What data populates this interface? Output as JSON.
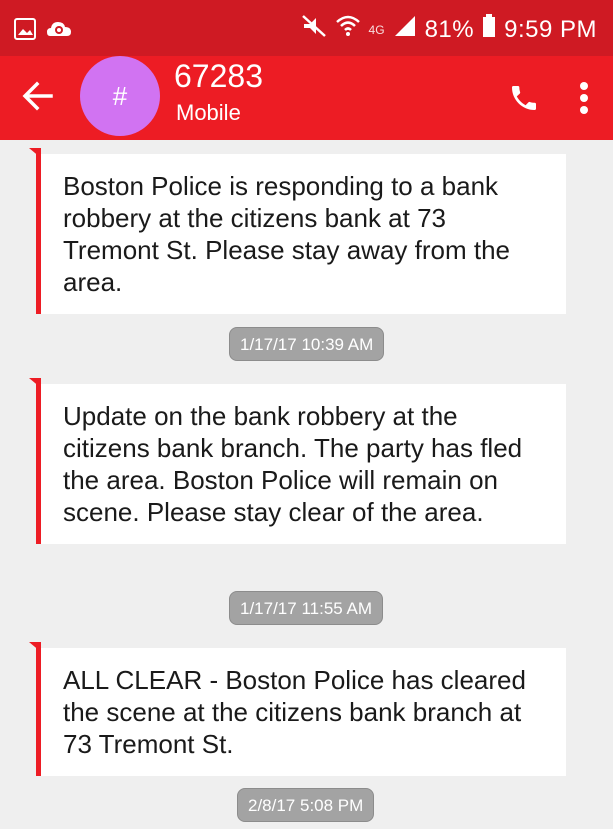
{
  "status_bar": {
    "battery": "81%",
    "time": "9:59 PM",
    "network": "4G"
  },
  "app_bar": {
    "avatar_glyph": "#",
    "contact_name": "67283",
    "contact_type": "Mobile"
  },
  "messages": [
    {
      "text": "Boston Police is responding to a bank robbery at the citizens bank at 73 Tremont St. Please stay away from the area.",
      "timestamp": "1/17/17 10:39 AM"
    },
    {
      "text": "Update on the bank robbery at the citizens bank branch. The party has fled the area. Boston Police will remain on scene. Please stay clear of the area.",
      "timestamp": "1/17/17 11:55 AM"
    },
    {
      "text": "ALL CLEAR - Boston Police has cleared the scene at the citizens bank branch at 73 Tremont St.",
      "timestamp": "2/8/17 5:08 PM"
    }
  ],
  "icons": {
    "gallery": "gallery-icon",
    "app_notification": "app-notification-icon",
    "mute": "mute-icon",
    "wifi": "wifi-icon",
    "signal": "signal-icon",
    "battery": "battery-icon",
    "back": "back-arrow-icon",
    "call": "phone-icon",
    "menu": "more-vert-icon"
  },
  "colors": {
    "accent": "#ed1c24",
    "status_bar": "#cf1a23",
    "avatar": "#d173f2",
    "background": "#efefef",
    "timestamp_bg": "#a3a3a3"
  }
}
